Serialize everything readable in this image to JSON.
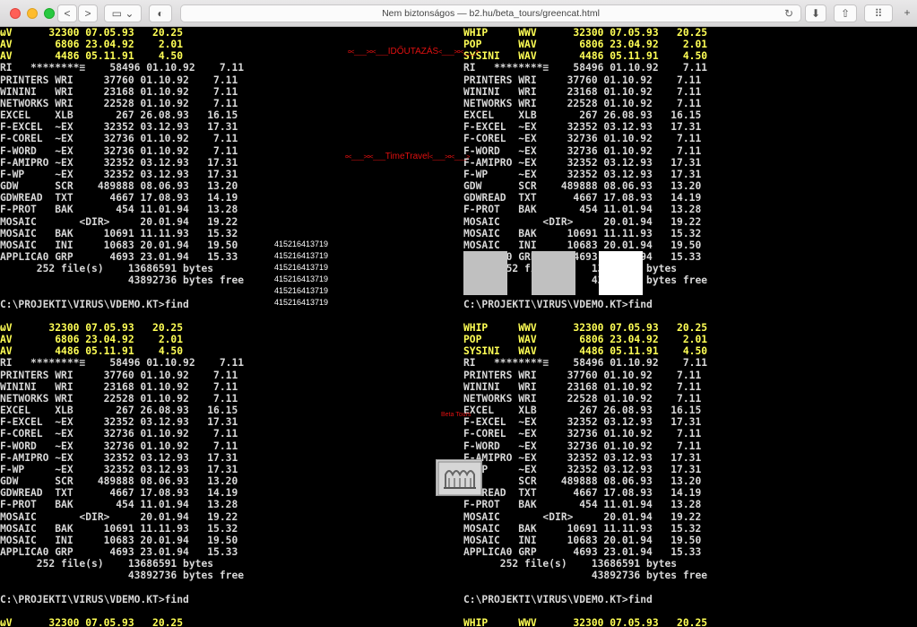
{
  "browser": {
    "url_text": "Nem biztonságos — b2.hu/beta_tours/greencat.html",
    "back_icon": "<",
    "forward_icon": ">",
    "sidebar_icon": "▭",
    "chevron_icon": "⌄",
    "shield_icon": "◐",
    "reload_icon": "↻",
    "download_icon": "⬇",
    "share_icon": "⇧",
    "grid_icon": "⠿",
    "newtab_icon": "+"
  },
  "console": {
    "top_left_lines": [
      "ωV      32300 07.05.93   20.25",
      "AV       6806 23.04.92    2.01",
      "AV       4486 05.11.91    4.50",
      "RI   ********≡    58496 01.10.92    7.11",
      "PRINTERS WRI     37760 01.10.92    7.11",
      "WININI   WRI     23168 01.10.92    7.11",
      "NETWORKS WRI     22528 01.10.92    7.11",
      "EXCEL    XLB       267 26.08.93   16.15",
      "F-EXCEL  ~EX     32352 03.12.93   17.31",
      "F-COREL  ~EX     32736 01.10.92    7.11",
      "F-WORD   ~EX     32736 01.10.92    7.11",
      "F-AMIPRO ~EX     32352 03.12.93   17.31",
      "F-WP     ~EX     32352 03.12.93   17.31",
      "GDW      SCR    489888 08.06.93   13.20",
      "GDWREAD  TXT      4667 17.08.93   14.19",
      "F-PROT   BAK       454 11.01.94   13.28",
      "MOSAIC       <DIR>     20.01.94   19.22",
      "MOSAIC   BAK     10691 11.11.93   15.32",
      "MOSAIC   INI     10683 20.01.94   19.50",
      "APPLICA0 GRP      4693 23.01.94   15.33",
      "      252 file(s)    13686591 bytes",
      "                     43892736 bytes free",
      "",
      "C:\\PROJEKTI\\VIRUS\\VDEMO.KT>find"
    ],
    "top_right_lines": [
      "WHIP     WWV      32300 07.05.93   20.25",
      "POP      WAV       6806 23.04.92    2.01",
      "SYSINI   WAV       4486 05.11.91    4.50",
      "RI   ********≡    58496 01.10.92    7.11",
      "PRINTERS WRI     37760 01.10.92    7.11",
      "WININI   WRI     23168 01.10.92    7.11",
      "NETWORKS WRI     22528 01.10.92    7.11",
      "EXCEL    XLB       267 26.08.93   16.15",
      "F-EXCEL  ~EX     32352 03.12.93   17.31",
      "F-COREL  ~EX     32736 01.10.92    7.11",
      "F-WORD   ~EX     32736 01.10.92    7.11",
      "F-AMIPRO ~EX     32352 03.12.93   17.31",
      "F-WP     ~EX     32352 03.12.93   17.31",
      "GDW      SCR    489888 08.06.93   13.20",
      "GDWREAD  TXT      4667 17.08.93   14.19",
      "F-PROT   BAK       454 11.01.94   13.28",
      "MOSAIC       <DIR>     20.01.94   19.22",
      "MOSAIC   BAK     10691 11.11.93   15.32",
      "MOSAIC   INI     10683 20.01.94   19.50",
      "APPLICA0 GRP      4693 23.01.94   15.33",
      "      252 file(s)    13686591 bytes",
      "                     43892736 bytes free",
      "",
      "C:\\PROJEKTI\\VIRUS\\VDEMO.KT>find"
    ],
    "bottom_left_first_line": "ωV      32300 07.05.93   20.25",
    "bottom_right_first_line": "WHIP     WWV      32300 07.05.93   20.25"
  },
  "overlay": {
    "idoutazas_link": "IDŐUTAZÁS",
    "timetravel_link": "TimeTravel",
    "link_prefix": "¤<____>¤<____",
    "link_suffix": "<____>¤<____>",
    "number_column": [
      "415216413719",
      "415216413719",
      "415216413719",
      "415216413719",
      "415216413719",
      "415216413719"
    ],
    "beta_tours_label": "Beta Tours"
  },
  "colors": {
    "console_bg": "#000000",
    "console_text": "#d8d8d8",
    "console_highlight": "#ffff55",
    "link_red": "#e01010",
    "box_gray": "#c0c0c0",
    "box_white": "#ffffff"
  }
}
